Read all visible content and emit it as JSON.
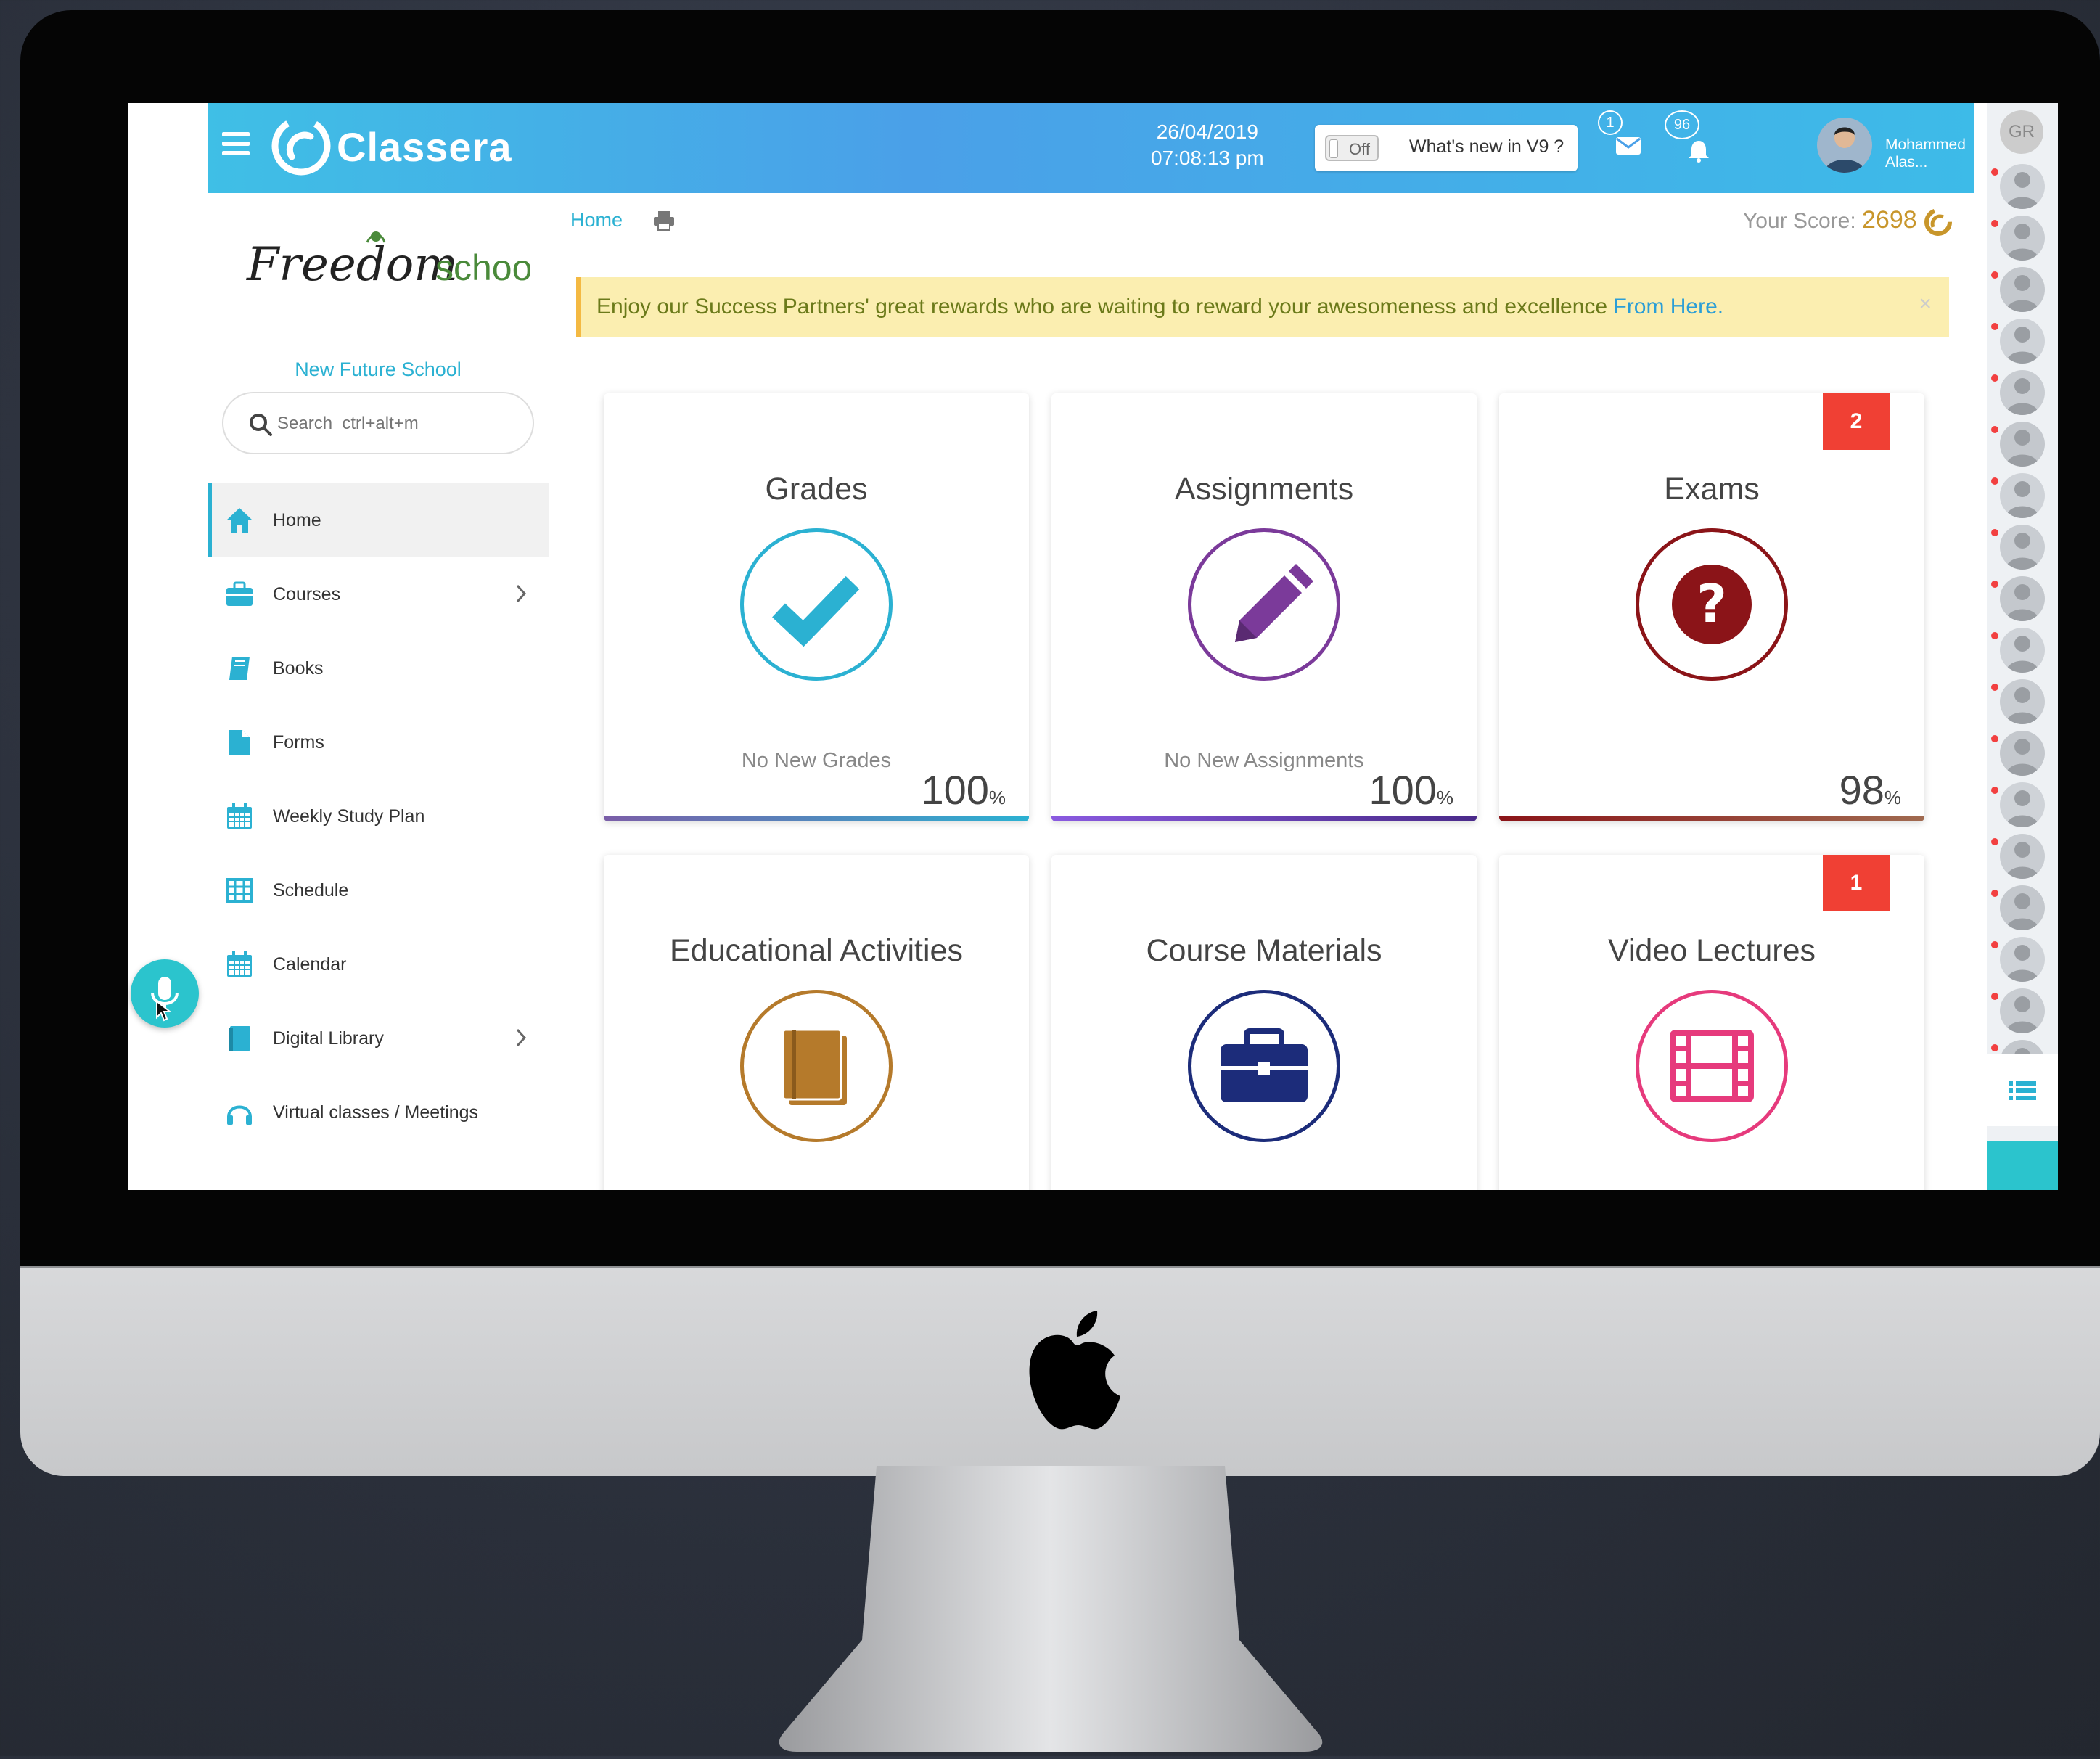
{
  "header": {
    "app_name": "Classera",
    "date": "26/04/2019",
    "time": "07:08:13 pm",
    "toggle_state": "Off",
    "whats_new": "What's new in V9 ?",
    "messages_count": "1",
    "notifications_count": "96",
    "user_name": "Mohammed Alas..."
  },
  "sidebar": {
    "school_logo_text": "Freedomschool",
    "school_name": "New Future School",
    "search_placeholder": "Search  ctrl+alt+m",
    "items": [
      {
        "label": "Home",
        "icon": "home-icon",
        "active": true
      },
      {
        "label": "Courses",
        "icon": "briefcase-icon",
        "has_children": true
      },
      {
        "label": "Books",
        "icon": "book-icon"
      },
      {
        "label": "Forms",
        "icon": "file-icon"
      },
      {
        "label": "Weekly Study Plan",
        "icon": "calendar-icon"
      },
      {
        "label": "Schedule",
        "icon": "table-icon"
      },
      {
        "label": "Calendar",
        "icon": "calendar-icon"
      },
      {
        "label": "Digital Library",
        "icon": "book-icon",
        "has_children": true
      },
      {
        "label": "Virtual classes / Meetings",
        "icon": "headphones-icon"
      }
    ]
  },
  "breadcrumb": {
    "home": "Home"
  },
  "score": {
    "label": "Your Score:",
    "value": "2698"
  },
  "banner": {
    "text": "Enjoy our Success Partners' great rewards who are waiting to reward your awesomeness and excellence",
    "link": "From Here."
  },
  "cards": [
    {
      "title": "Grades",
      "subtitle": "No New Grades",
      "percent": "100",
      "unit": "%",
      "color": "#2bb1d2",
      "icon": "check-icon"
    },
    {
      "title": "Assignments",
      "subtitle": "No New Assignments",
      "percent": "100",
      "unit": "%",
      "color": "#7b3a9a",
      "icon": "pencil-icon"
    },
    {
      "title": "Exams",
      "subtitle": "",
      "percent": "98",
      "unit": "%",
      "badge": "2",
      "color": "#8b1418",
      "icon": "question-icon"
    },
    {
      "title": "Educational Activities",
      "color": "#b57a2b",
      "icon": "book-icon"
    },
    {
      "title": "Course Materials",
      "color": "#1c2c7a",
      "icon": "briefcase-icon"
    },
    {
      "title": "Video Lectures",
      "badge": "1",
      "color": "#e63a7c",
      "icon": "film-icon"
    }
  ],
  "rail": {
    "group_label": "GR"
  },
  "colors": {
    "accent": "#2bb1d2",
    "badge": "#f04034",
    "banner_bg": "#fbeeb0"
  }
}
